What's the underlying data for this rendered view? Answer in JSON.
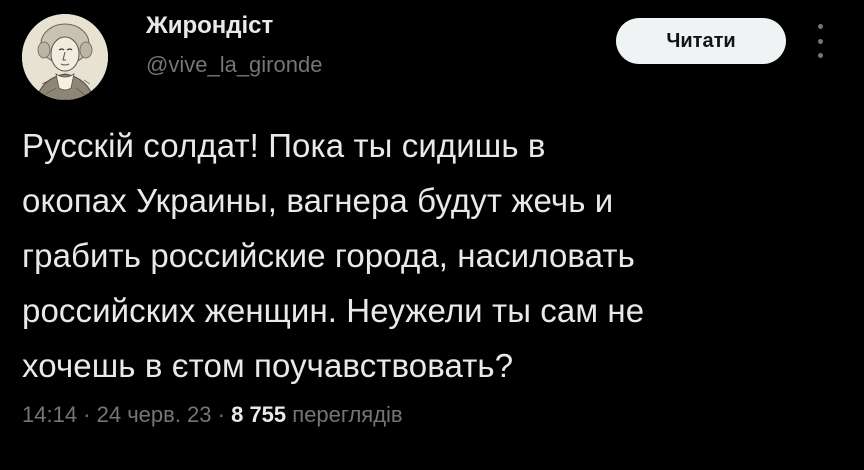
{
  "author": {
    "name": "Жирондіст",
    "handle": "@vive_la_gironde"
  },
  "follow_button": {
    "label": "Читати"
  },
  "tweet": {
    "lines": [
      "Русскій солдат! Пока ты сидишь в",
      "окопах Украины, вагнера будут жечь и",
      "грабить российские города, насиловать",
      "российских женщин. Неужели ты сам не",
      "хочешь в єтом поучавствовать?"
    ]
  },
  "meta": {
    "time": "14:14",
    "separator": " · ",
    "date": "24 черв. 23",
    "views_count": "8 755",
    "views_label": "переглядів"
  },
  "icons": {
    "avatar": "portrait-avatar",
    "more": "more-options-icon"
  },
  "colors": {
    "background": "#000000",
    "text": "#e7e9ea",
    "secondary": "#71767b",
    "button_bg": "#eff3f4"
  }
}
